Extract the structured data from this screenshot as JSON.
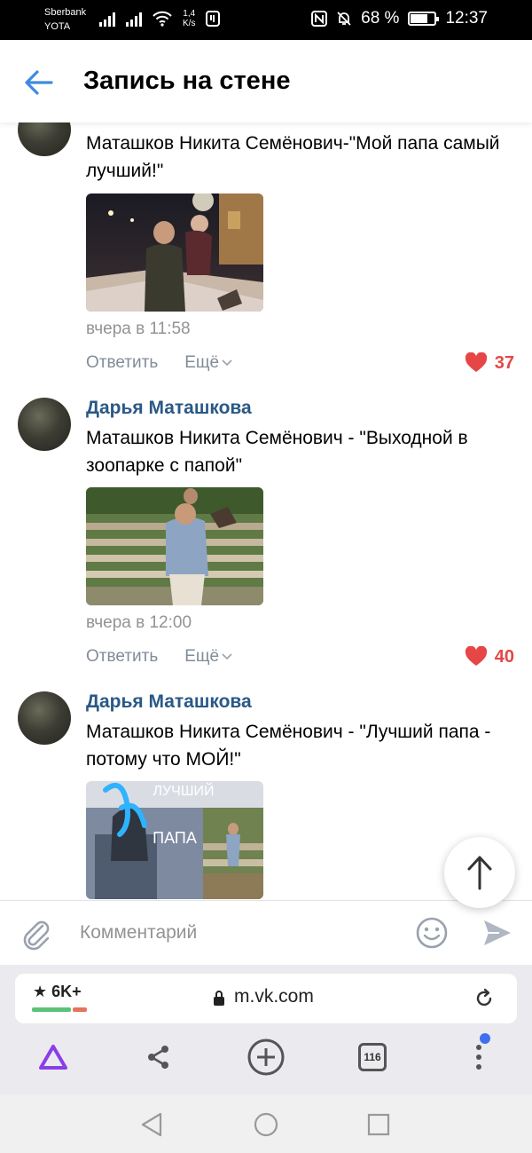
{
  "status_bar": {
    "carrier_1": "Sberbank",
    "carrier_2": "YOTA",
    "net_speed_value": "1,4",
    "net_speed_unit": "K/s",
    "battery": "68 %",
    "battery_level": 0.68,
    "time": "12:37"
  },
  "header": {
    "title": "Запись на стене"
  },
  "comments": [
    {
      "author": "",
      "text": "Маташков Никита Семёнович-\"Мой папа самый лучший!\"",
      "time": "вчера в 11:58",
      "reply": "Ответить",
      "more": "Ещё",
      "likes": "37"
    },
    {
      "author": "Дарья Маташкова",
      "text": "Маташков Никита Семёнович - \"Выходной в зоопарке с папой\"",
      "time": "вчера в 12:00",
      "reply": "Ответить",
      "more": "Ещё",
      "likes": "40"
    },
    {
      "author": "Дарья Маташкова",
      "text": "Маташков Никита Семёнович - \"Лучший папа - потому что МОЙ!\"",
      "photo_caption_top": "ЛУЧШИЙ",
      "photo_caption_bottom": "ПАПА"
    }
  ],
  "composer": {
    "placeholder": "Комментарий"
  },
  "browser": {
    "rating": "★ 6K+",
    "url": "m.vk.com",
    "tabs_count": "116"
  },
  "colors": {
    "link": "#2a5885",
    "like": "#e64646",
    "accent": "#3f8ae0"
  }
}
